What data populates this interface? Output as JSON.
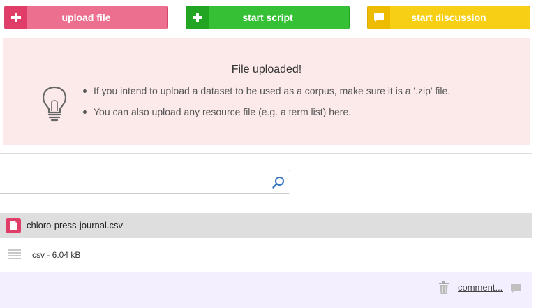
{
  "actions": {
    "upload_label": "upload file",
    "script_label": "start script",
    "discussion_label": "start discussion"
  },
  "info": {
    "title": "File uploaded!",
    "items": [
      "If you intend to upload a dataset to be used as a corpus, make sure it is a '.zip' file.",
      "You can also upload any resource file (e.g. a term list) here."
    ],
    "icon": "lightbulb-icon"
  },
  "search": {
    "value": "",
    "placeholder": "",
    "icon": "search-icon"
  },
  "file": {
    "name": "chloro-press-journal.csv",
    "meta": "csv - 6.04 kB",
    "comment_label": "comment..."
  },
  "colors": {
    "upload": "#ec6f8f",
    "script": "#35c036",
    "discussion": "#f7cf14",
    "info_bg": "#fce9ea",
    "file_row": "#dedede",
    "comment_bar": "#f3efff"
  }
}
